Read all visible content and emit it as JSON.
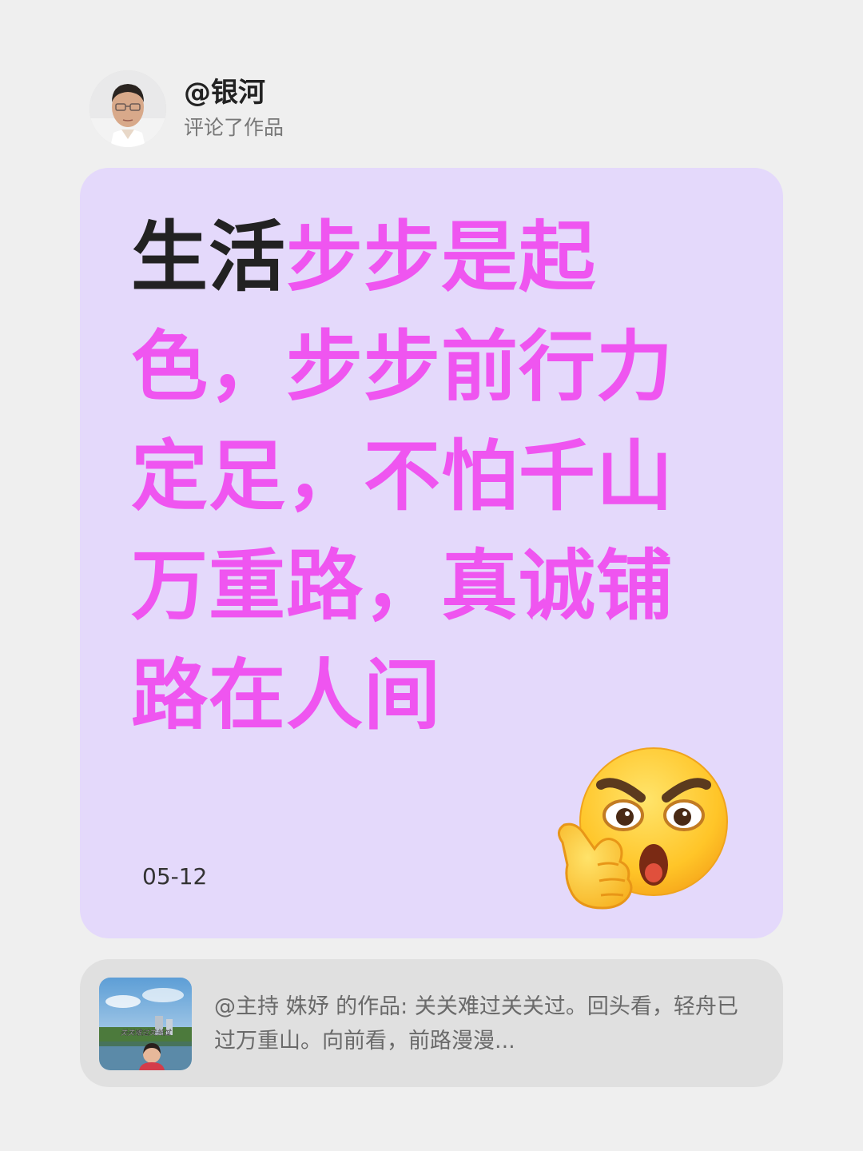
{
  "header": {
    "username": "@银河",
    "action": "评论了作品",
    "avatar_icon": "person-photo-avatar"
  },
  "comment": {
    "text_black": "生活",
    "text_pink": "步步是起色，步步前行力定足，不怕千山万重路，真诚铺路在人间",
    "date": "05-12",
    "emoji_icon": "thinking-angry-face-emoji"
  },
  "referenced_work": {
    "author_label": "@主持 姝妤",
    "prefix_text": " 的作品: ",
    "excerpt": "关关难过关关过。回头看，轻舟已过万重山。向前看，前路漫漫...",
    "thumbnail_caption": "关关难过关关过",
    "thumbnail_icon": "lake-landscape-thumbnail"
  },
  "colors": {
    "background": "#efefef",
    "card": "#e4d9fb",
    "accent_pink": "#ef55f0",
    "ref_card": "#e0e0e0"
  }
}
